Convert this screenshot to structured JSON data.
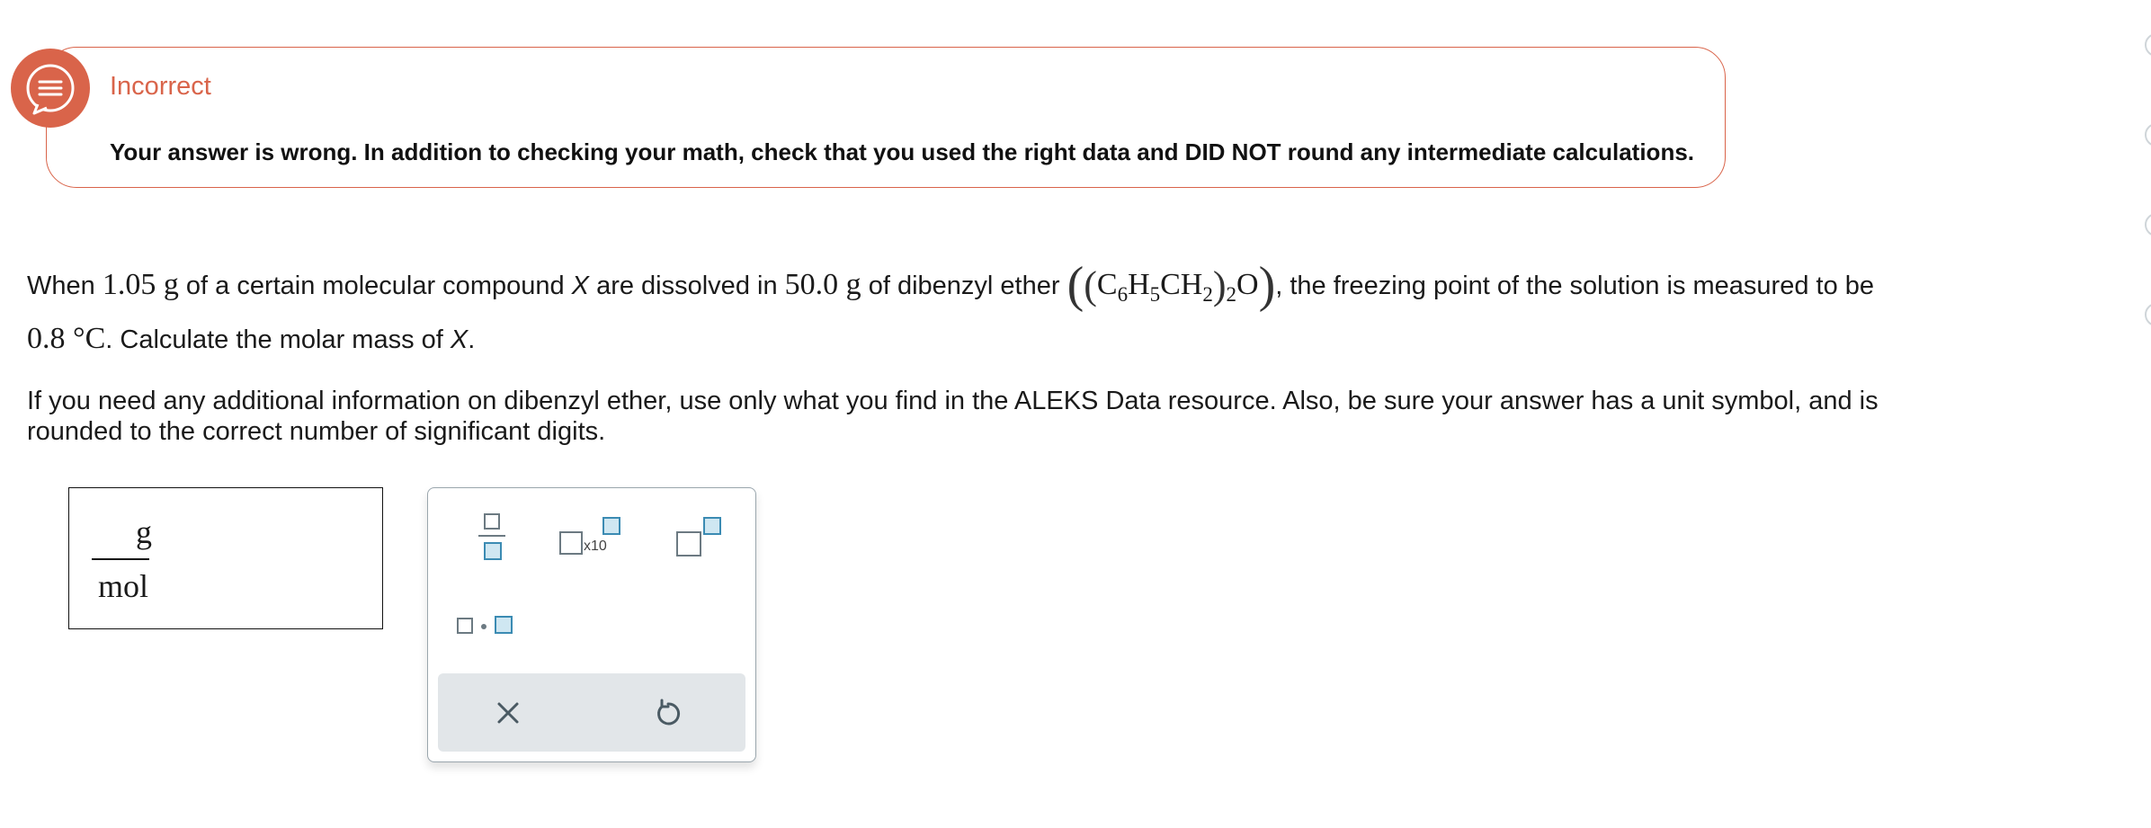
{
  "feedback": {
    "title": "Incorrect",
    "message": "Your answer is wrong. In addition to checking your math, check that you used the right data and DID NOT round any intermediate calculations."
  },
  "question": {
    "p1_a": "When ",
    "mass_value": "1.05 g",
    "p1_b": " of a certain molecular compound ",
    "compound": "X",
    "p1_c": " are dissolved in ",
    "solvent_mass": "50.0 g",
    "p1_d": " of dibenzyl ether ",
    "p1_e": ", the freezing point of the solution is measured to be",
    "freezing_point": "0.8 °C",
    "p2_a": ". Calculate the molar mass of ",
    "p2_b": ".",
    "instructions_line1": "If you need any additional information on dibenzyl ether, use only what you find in the ALEKS Data resource. Also, be sure your answer has a unit symbol, and is",
    "instructions_line2": "rounded to the correct number of significant digits."
  },
  "formula": {
    "c": "C",
    "c_sub": "6",
    "h": "H",
    "h_sub": "5",
    "ch": "CH",
    "ch_sub": "2",
    "group_sub": "2",
    "o": "O"
  },
  "answer": {
    "unit_numerator": "g",
    "unit_denominator": "mol"
  },
  "palette": {
    "x10_label": "x10",
    "tools": [
      "fraction",
      "times-ten-power",
      "superscript",
      "multiply-dot",
      "clear",
      "undo"
    ]
  },
  "colors": {
    "error": "#d9644a",
    "slot_border": "#3b8bb3",
    "slot_fill": "#cfe7f2",
    "footer": "#e2e6e9"
  }
}
